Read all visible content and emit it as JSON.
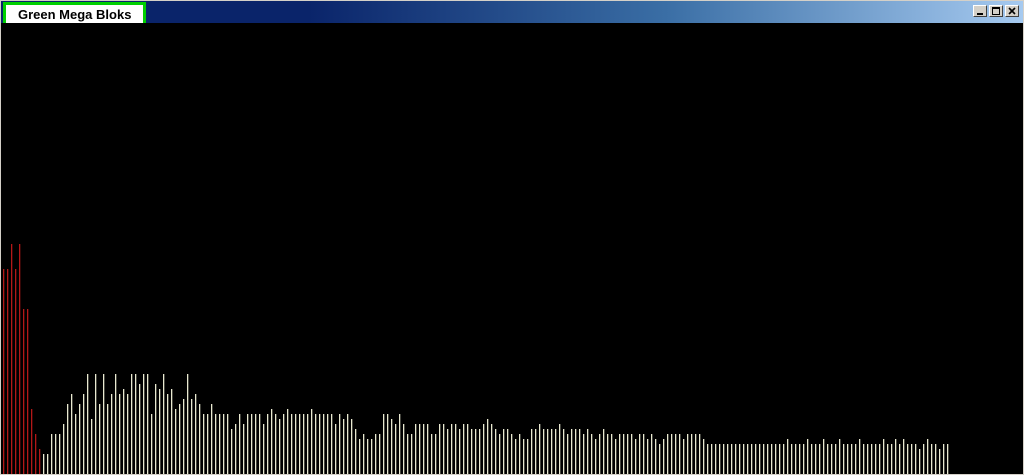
{
  "window": {
    "title": "Green Mega Bloks",
    "buttons": [
      "minimize-icon",
      "maximize-icon",
      "close-icon"
    ]
  },
  "colors": {
    "background": "#000000",
    "bar_primary": "#e8e8d0",
    "bar_highlight": "#b31818",
    "title_outline": "#00d000"
  },
  "chart_data": {
    "type": "bar",
    "title": "",
    "xlabel": "",
    "ylabel": "",
    "ylim": [
      0,
      451
    ],
    "highlight_count": 10,
    "values": [
      205,
      205,
      230,
      205,
      230,
      165,
      165,
      65,
      40,
      25,
      20,
      20,
      40,
      40,
      40,
      50,
      70,
      80,
      60,
      70,
      80,
      100,
      55,
      100,
      70,
      100,
      70,
      80,
      100,
      80,
      85,
      80,
      100,
      100,
      90,
      100,
      100,
      60,
      90,
      85,
      100,
      80,
      85,
      65,
      70,
      75,
      100,
      75,
      80,
      70,
      60,
      60,
      70,
      60,
      60,
      60,
      60,
      45,
      50,
      60,
      50,
      60,
      60,
      60,
      60,
      50,
      60,
      65,
      60,
      55,
      60,
      65,
      60,
      60,
      60,
      60,
      60,
      65,
      60,
      60,
      60,
      60,
      60,
      50,
      60,
      55,
      60,
      55,
      45,
      35,
      40,
      35,
      35,
      40,
      40,
      60,
      60,
      55,
      50,
      60,
      50,
      40,
      40,
      50,
      50,
      50,
      50,
      40,
      40,
      50,
      50,
      45,
      50,
      50,
      45,
      50,
      50,
      45,
      45,
      45,
      50,
      55,
      50,
      45,
      40,
      45,
      45,
      40,
      35,
      40,
      35,
      35,
      45,
      45,
      50,
      45,
      45,
      45,
      45,
      50,
      45,
      40,
      45,
      45,
      45,
      40,
      45,
      40,
      35,
      40,
      45,
      40,
      40,
      35,
      40,
      40,
      40,
      40,
      35,
      40,
      40,
      35,
      40,
      35,
      30,
      35,
      40,
      40,
      40,
      40,
      35,
      40,
      40,
      40,
      40,
      35,
      30,
      30,
      30,
      30,
      30,
      30,
      30,
      30,
      30,
      30,
      30,
      30,
      30,
      30,
      30,
      30,
      30,
      30,
      30,
      30,
      35,
      30,
      30,
      30,
      30,
      35,
      30,
      30,
      30,
      35,
      30,
      30,
      30,
      35,
      30,
      30,
      30,
      30,
      35,
      30,
      30,
      30,
      30,
      30,
      35,
      30,
      30,
      35,
      30,
      35,
      30,
      30,
      30,
      25,
      30,
      35,
      30,
      30,
      25,
      30,
      30
    ]
  }
}
